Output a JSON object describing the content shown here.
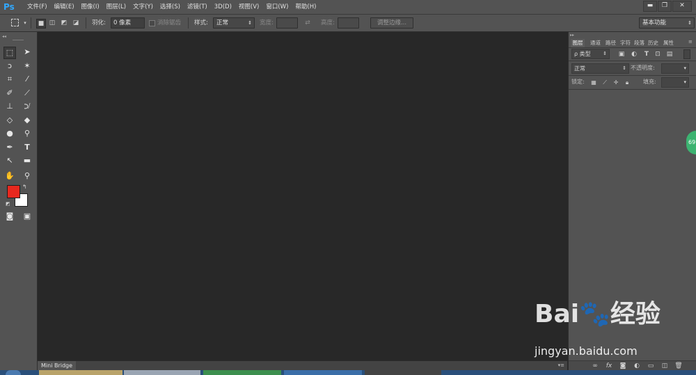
{
  "app": {
    "logo": "Ps"
  },
  "menu": [
    "文件(F)",
    "编辑(E)",
    "图像(I)",
    "图层(L)",
    "文字(Y)",
    "选择(S)",
    "滤镜(T)",
    "3D(D)",
    "视图(V)",
    "窗口(W)",
    "帮助(H)"
  ],
  "window_controls": {
    "minimize": "▬",
    "restore": "❐",
    "close": "✕"
  },
  "options": {
    "feather_label": "羽化:",
    "feather_value": "0 像素",
    "antialias_label": "消除锯齿",
    "style_label": "样式:",
    "style_value": "正常",
    "width_label": "宽度:",
    "height_label": "高度:",
    "refine_button": "调整边缘...",
    "workspace": "基本功能"
  },
  "minibridge": {
    "label": "Mini Bridge"
  },
  "layers_panel": {
    "tabs": [
      "图层",
      "通道",
      "路径",
      "字符",
      "段落",
      "历史",
      "属性"
    ],
    "filter_label": "ρ 类型",
    "blend_mode": "正常",
    "opacity_label": "不透明度:",
    "lock_label": "锁定:",
    "fill_label": "填充:"
  },
  "watermark": {
    "logo": "Bai🐾经验",
    "url": "jingyan.baidu.com"
  },
  "badge": {
    "value": "69"
  },
  "colors": {
    "foreground": "#e8281e",
    "background": "#ffffff",
    "accent": "#31a8ff"
  }
}
